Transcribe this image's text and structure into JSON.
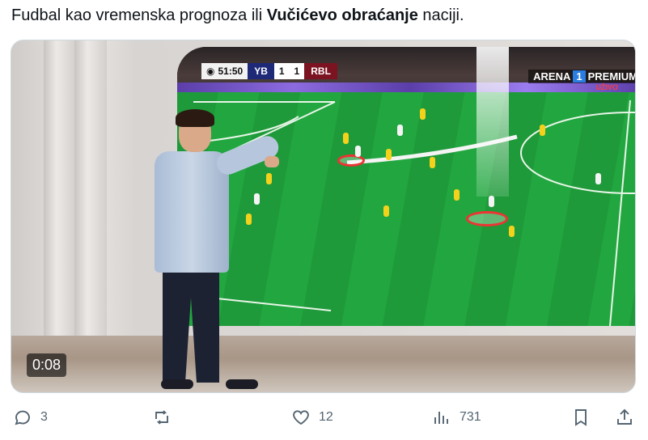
{
  "tweet": {
    "text_before": "Fudbal kao vremenska prognoza ili ",
    "text_bold": "Vučićevo obraćanje",
    "text_after": " naciji."
  },
  "video": {
    "timestamp": "0:08",
    "scoreboard": {
      "clock": "51:50",
      "home_team": "YB",
      "home_score": "1",
      "away_score": "1",
      "away_team": "RBL"
    },
    "channel": {
      "name": "ARENA",
      "number": "1",
      "tier": "PREMIUM",
      "live_label": "UŽIVO"
    }
  },
  "actions": {
    "reply_count": "3",
    "retweet_count": "",
    "like_count": "12",
    "views_count": "731"
  },
  "colors": {
    "icon_gray": "#536471",
    "text": "#0f1419",
    "pitch_green": "#22a740"
  }
}
